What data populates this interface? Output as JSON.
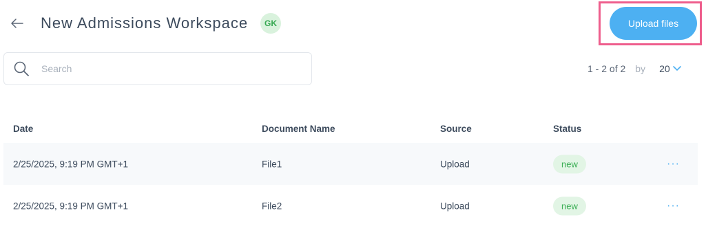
{
  "header": {
    "title": "New Admissions Workspace",
    "avatar_initials": "GK",
    "upload_label": "Upload files"
  },
  "search": {
    "placeholder": "Search",
    "value": ""
  },
  "pagination": {
    "range": "1 - 2 of 2",
    "by": "by",
    "page_size": "20"
  },
  "table": {
    "columns": {
      "date": "Date",
      "name": "Document Name",
      "source": "Source",
      "status": "Status"
    },
    "rows": [
      {
        "date": "2/25/2025, 9:19 PM GMT+1",
        "name": "File1",
        "source": "Upload",
        "status": "new",
        "actions": "···"
      },
      {
        "date": "2/25/2025, 9:19 PM GMT+1",
        "name": "File2",
        "source": "Upload",
        "status": "new",
        "actions": "···"
      }
    ]
  },
  "colors": {
    "accent": "#4db0f2",
    "highlight": "#ee5d8c",
    "status_new_bg": "#e2f5e5",
    "status_new_text": "#3cae55"
  },
  "icons": {
    "back": "arrow-left-icon",
    "search": "search-icon",
    "page_size": "chevron-down-icon"
  }
}
